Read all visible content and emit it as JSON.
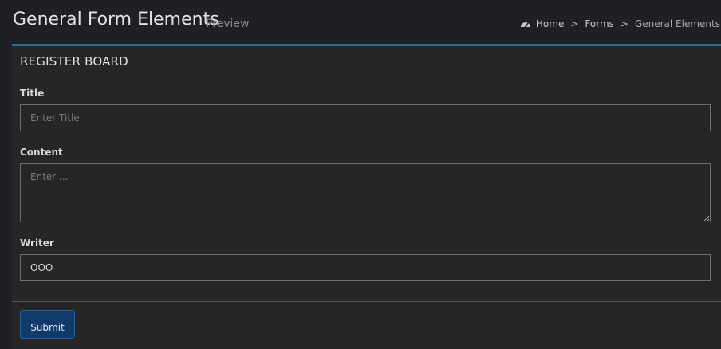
{
  "header": {
    "title": "General Form Elements",
    "subtitle": "Preview",
    "breadcrumb": {
      "icon": "dashboard-icon",
      "items": [
        "Home",
        "Forms",
        "General Elements"
      ],
      "separator": ">"
    }
  },
  "form": {
    "box_title": "REGISTER BOARD",
    "accent_color": "#2d6b97",
    "title_label": "Title",
    "title_placeholder": "Enter Title",
    "title_value": "",
    "content_label": "Content",
    "content_placeholder": "Enter ...",
    "content_value": "",
    "writer_label": "Writer",
    "writer_value": "OOO",
    "submit_label": "Submit"
  }
}
